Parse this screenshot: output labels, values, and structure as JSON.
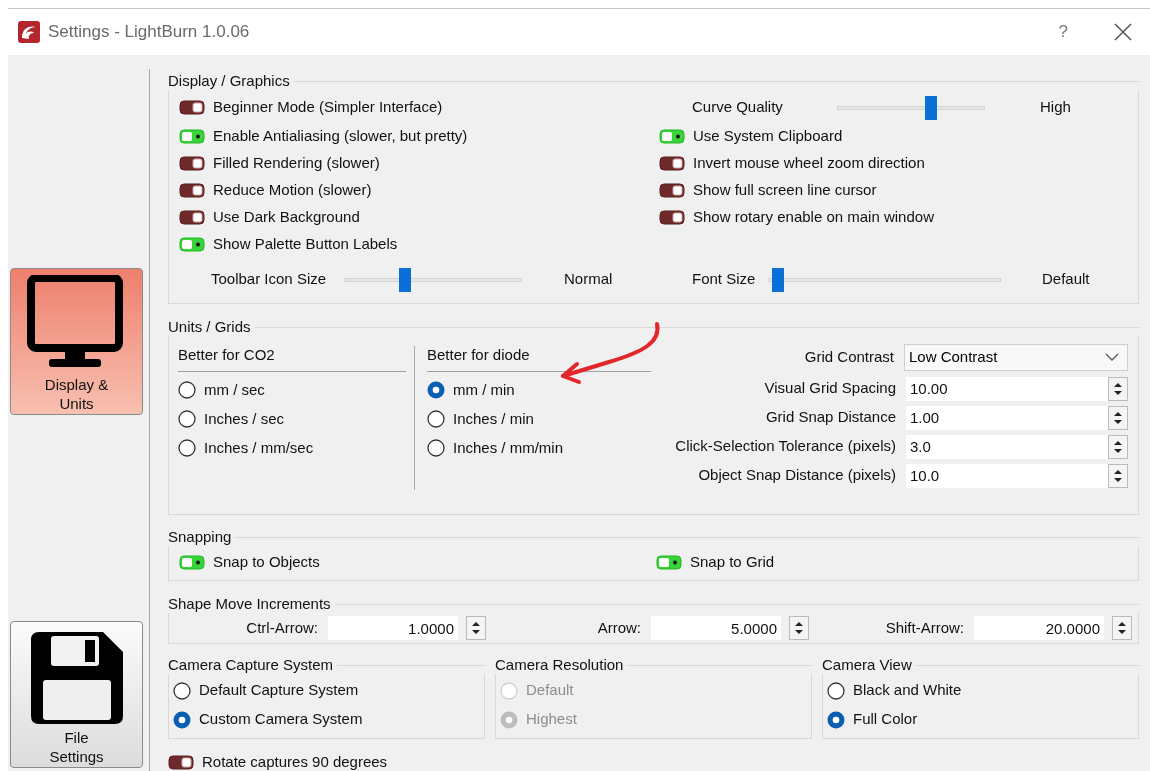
{
  "window": {
    "title": "Settings - LightBurn 1.0.06",
    "help": "?"
  },
  "sidebar": {
    "items": [
      {
        "label": "Display & Units",
        "kind": "monitor",
        "selected": true
      },
      {
        "label": "File Settings",
        "kind": "floppy",
        "selected": false
      }
    ]
  },
  "display_graphics": {
    "title": "Display / Graphics",
    "left_toggles": [
      {
        "label": "Beginner Mode (Simpler Interface)",
        "on": false
      },
      {
        "label": "Enable Antialiasing (slower, but pretty)",
        "on": true
      },
      {
        "label": "Filled Rendering (slower)",
        "on": false
      },
      {
        "label": "Reduce Motion (slower)",
        "on": false
      },
      {
        "label": "Use Dark Background",
        "on": false
      },
      {
        "label": "Show Palette Button Labels",
        "on": true
      }
    ],
    "curve_quality": {
      "label": "Curve Quality",
      "level": 0.65,
      "reading": "High"
    },
    "right_toggles": [
      {
        "label": "Use System Clipboard",
        "on": true
      },
      {
        "label": "Invert mouse wheel zoom direction",
        "on": false
      },
      {
        "label": "Show full screen line cursor",
        "on": false
      },
      {
        "label": "Show rotary enable on main window",
        "on": false
      }
    ],
    "toolbar_icon_size": {
      "label": "Toolbar Icon Size",
      "level": 0.33,
      "reading": "Normal"
    },
    "font_size": {
      "label": "Font Size",
      "level": 0.02,
      "reading": "Default"
    }
  },
  "units_grids": {
    "title": "Units / Grids",
    "unit_groups": [
      {
        "heading": "Better for CO2",
        "options": [
          {
            "label": "mm / sec",
            "selected": false
          },
          {
            "label": "Inches / sec",
            "selected": false
          },
          {
            "label": "Inches / mm/sec",
            "selected": false
          }
        ]
      },
      {
        "heading": "Better for diode",
        "options": [
          {
            "label": "mm / min",
            "selected": true
          },
          {
            "label": "Inches / min",
            "selected": false
          },
          {
            "label": "Inches / mm/min",
            "selected": false
          }
        ]
      }
    ],
    "fields": [
      {
        "kind": "select",
        "label": "Grid Contrast",
        "value": "Low Contrast"
      },
      {
        "kind": "spin",
        "label": "Visual Grid Spacing",
        "value": "10.00"
      },
      {
        "kind": "spin",
        "label": "Grid Snap Distance",
        "value": "1.00"
      },
      {
        "kind": "spin",
        "label": "Click-Selection Tolerance (pixels)",
        "value": "3.0"
      },
      {
        "kind": "spin",
        "label": "Object Snap Distance (pixels)",
        "value": "10.0"
      }
    ]
  },
  "snapping": {
    "title": "Snapping",
    "toggles": [
      {
        "label": "Snap to Objects",
        "on": true
      },
      {
        "label": "Snap to Grid",
        "on": true
      }
    ]
  },
  "shape_move_increments": {
    "title": "Shape Move Increments",
    "fields": [
      {
        "label": "Ctrl-Arrow:",
        "value": "1.0000"
      },
      {
        "label": "Arrow:",
        "value": "5.0000"
      },
      {
        "label": "Shift-Arrow:",
        "value": "20.0000"
      }
    ]
  },
  "camera_groups": [
    {
      "title": "Camera Capture System",
      "disabled": false,
      "options": [
        {
          "label": "Default Capture System",
          "selected": false
        },
        {
          "label": "Custom Camera System",
          "selected": true
        }
      ]
    },
    {
      "title": "Camera Resolution",
      "disabled": true,
      "options": [
        {
          "label": "Default",
          "selected": false
        },
        {
          "label": "Highest",
          "selected": true
        }
      ]
    },
    {
      "title": "Camera View",
      "disabled": false,
      "options": [
        {
          "label": "Black and White",
          "selected": false
        },
        {
          "label": "Full Color",
          "selected": true
        }
      ]
    }
  ],
  "rotate_captures": {
    "label": "Rotate captures 90 degrees",
    "on": false
  }
}
